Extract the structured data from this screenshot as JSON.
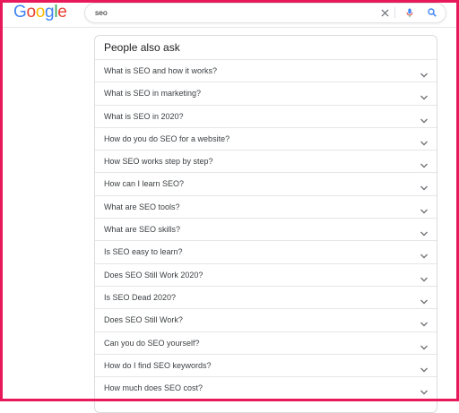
{
  "header": {
    "logo": [
      {
        "ch": "G",
        "color": "#4285F4"
      },
      {
        "ch": "o",
        "color": "#EA4335"
      },
      {
        "ch": "o",
        "color": "#FBBC05"
      },
      {
        "ch": "g",
        "color": "#4285F4"
      },
      {
        "ch": "l",
        "color": "#34A853"
      },
      {
        "ch": "e",
        "color": "#EA4335"
      }
    ],
    "search": {
      "value": "seo",
      "icons": [
        "close-icon",
        "mic-icon",
        "search-icon"
      ]
    }
  },
  "paa": {
    "title": "People also ask",
    "questions": [
      "What is SEO and how it works?",
      "What is SEO in marketing?",
      "What is SEO in 2020?",
      "How do you do SEO for a website?",
      "How SEO works step by step?",
      "How can I learn SEO?",
      "What are SEO tools?",
      "What are SEO skills?",
      "Is SEO easy to learn?",
      "Does SEO Still Work 2020?",
      "Is SEO Dead 2020?",
      "Does SEO Still Work?",
      "Can you do SEO yourself?",
      "How do I find SEO keywords?",
      "How much does SEO cost?"
    ]
  },
  "colors": {
    "frame": "#e8195a",
    "mic": "#4285F4",
    "search_icon": "#4285F4"
  }
}
